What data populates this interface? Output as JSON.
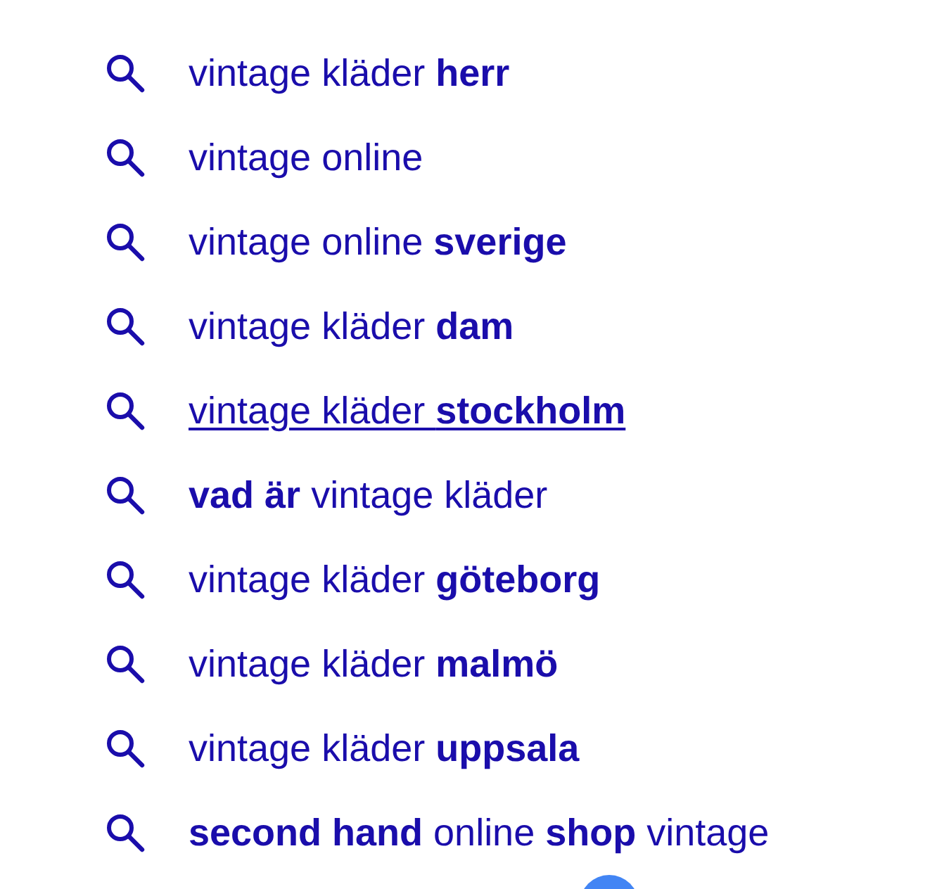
{
  "suggestions": [
    {
      "text": "vintage kläder **herr**",
      "hovered": false
    },
    {
      "text": "vintage online",
      "hovered": false
    },
    {
      "text": "vintage online **sverige**",
      "hovered": false
    },
    {
      "text": "vintage kläder **dam**",
      "hovered": false
    },
    {
      "text": "vintage kläder **stockholm**",
      "hovered": true
    },
    {
      "text": "**vad är** vintage kläder",
      "hovered": false
    },
    {
      "text": "vintage kläder **göteborg**",
      "hovered": false
    },
    {
      "text": "vintage kläder **malmö**",
      "hovered": false
    },
    {
      "text": "vintage kläder **uppsala**",
      "hovered": false
    },
    {
      "text": "**second hand** online **shop** vintage",
      "hovered": false
    }
  ]
}
